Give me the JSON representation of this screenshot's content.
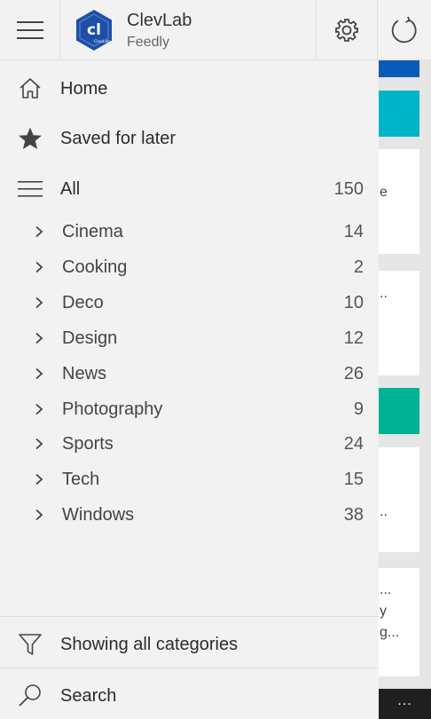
{
  "header": {
    "account_name": "ClevLab",
    "account_source": "Feedly",
    "logo_text": "cl",
    "logo_subtext": "ClevLab"
  },
  "nav": {
    "home_label": "Home",
    "saved_label": "Saved for later",
    "all_label": "All",
    "all_count": "150",
    "categories": [
      {
        "label": "Cinema",
        "count": "14"
      },
      {
        "label": "Cooking",
        "count": "2"
      },
      {
        "label": "Deco",
        "count": "10"
      },
      {
        "label": "Design",
        "count": "12"
      },
      {
        "label": "News",
        "count": "26"
      },
      {
        "label": "Photography",
        "count": "9"
      },
      {
        "label": "Sports",
        "count": "24"
      },
      {
        "label": "Tech",
        "count": "15"
      },
      {
        "label": "Windows",
        "count": "38"
      }
    ]
  },
  "footer": {
    "filter_label": "Showing all categories",
    "search_label": "Search"
  },
  "background": {
    "fragments": [
      "e",
      "..",
      "..",
      "...",
      "y",
      "g..."
    ],
    "more_label": "..."
  },
  "colors": {
    "logo_blue": "#1e4fa8",
    "accent_blue": "#0b5cb8",
    "accent_cyan": "#00b4c8",
    "accent_green": "#00b294"
  }
}
